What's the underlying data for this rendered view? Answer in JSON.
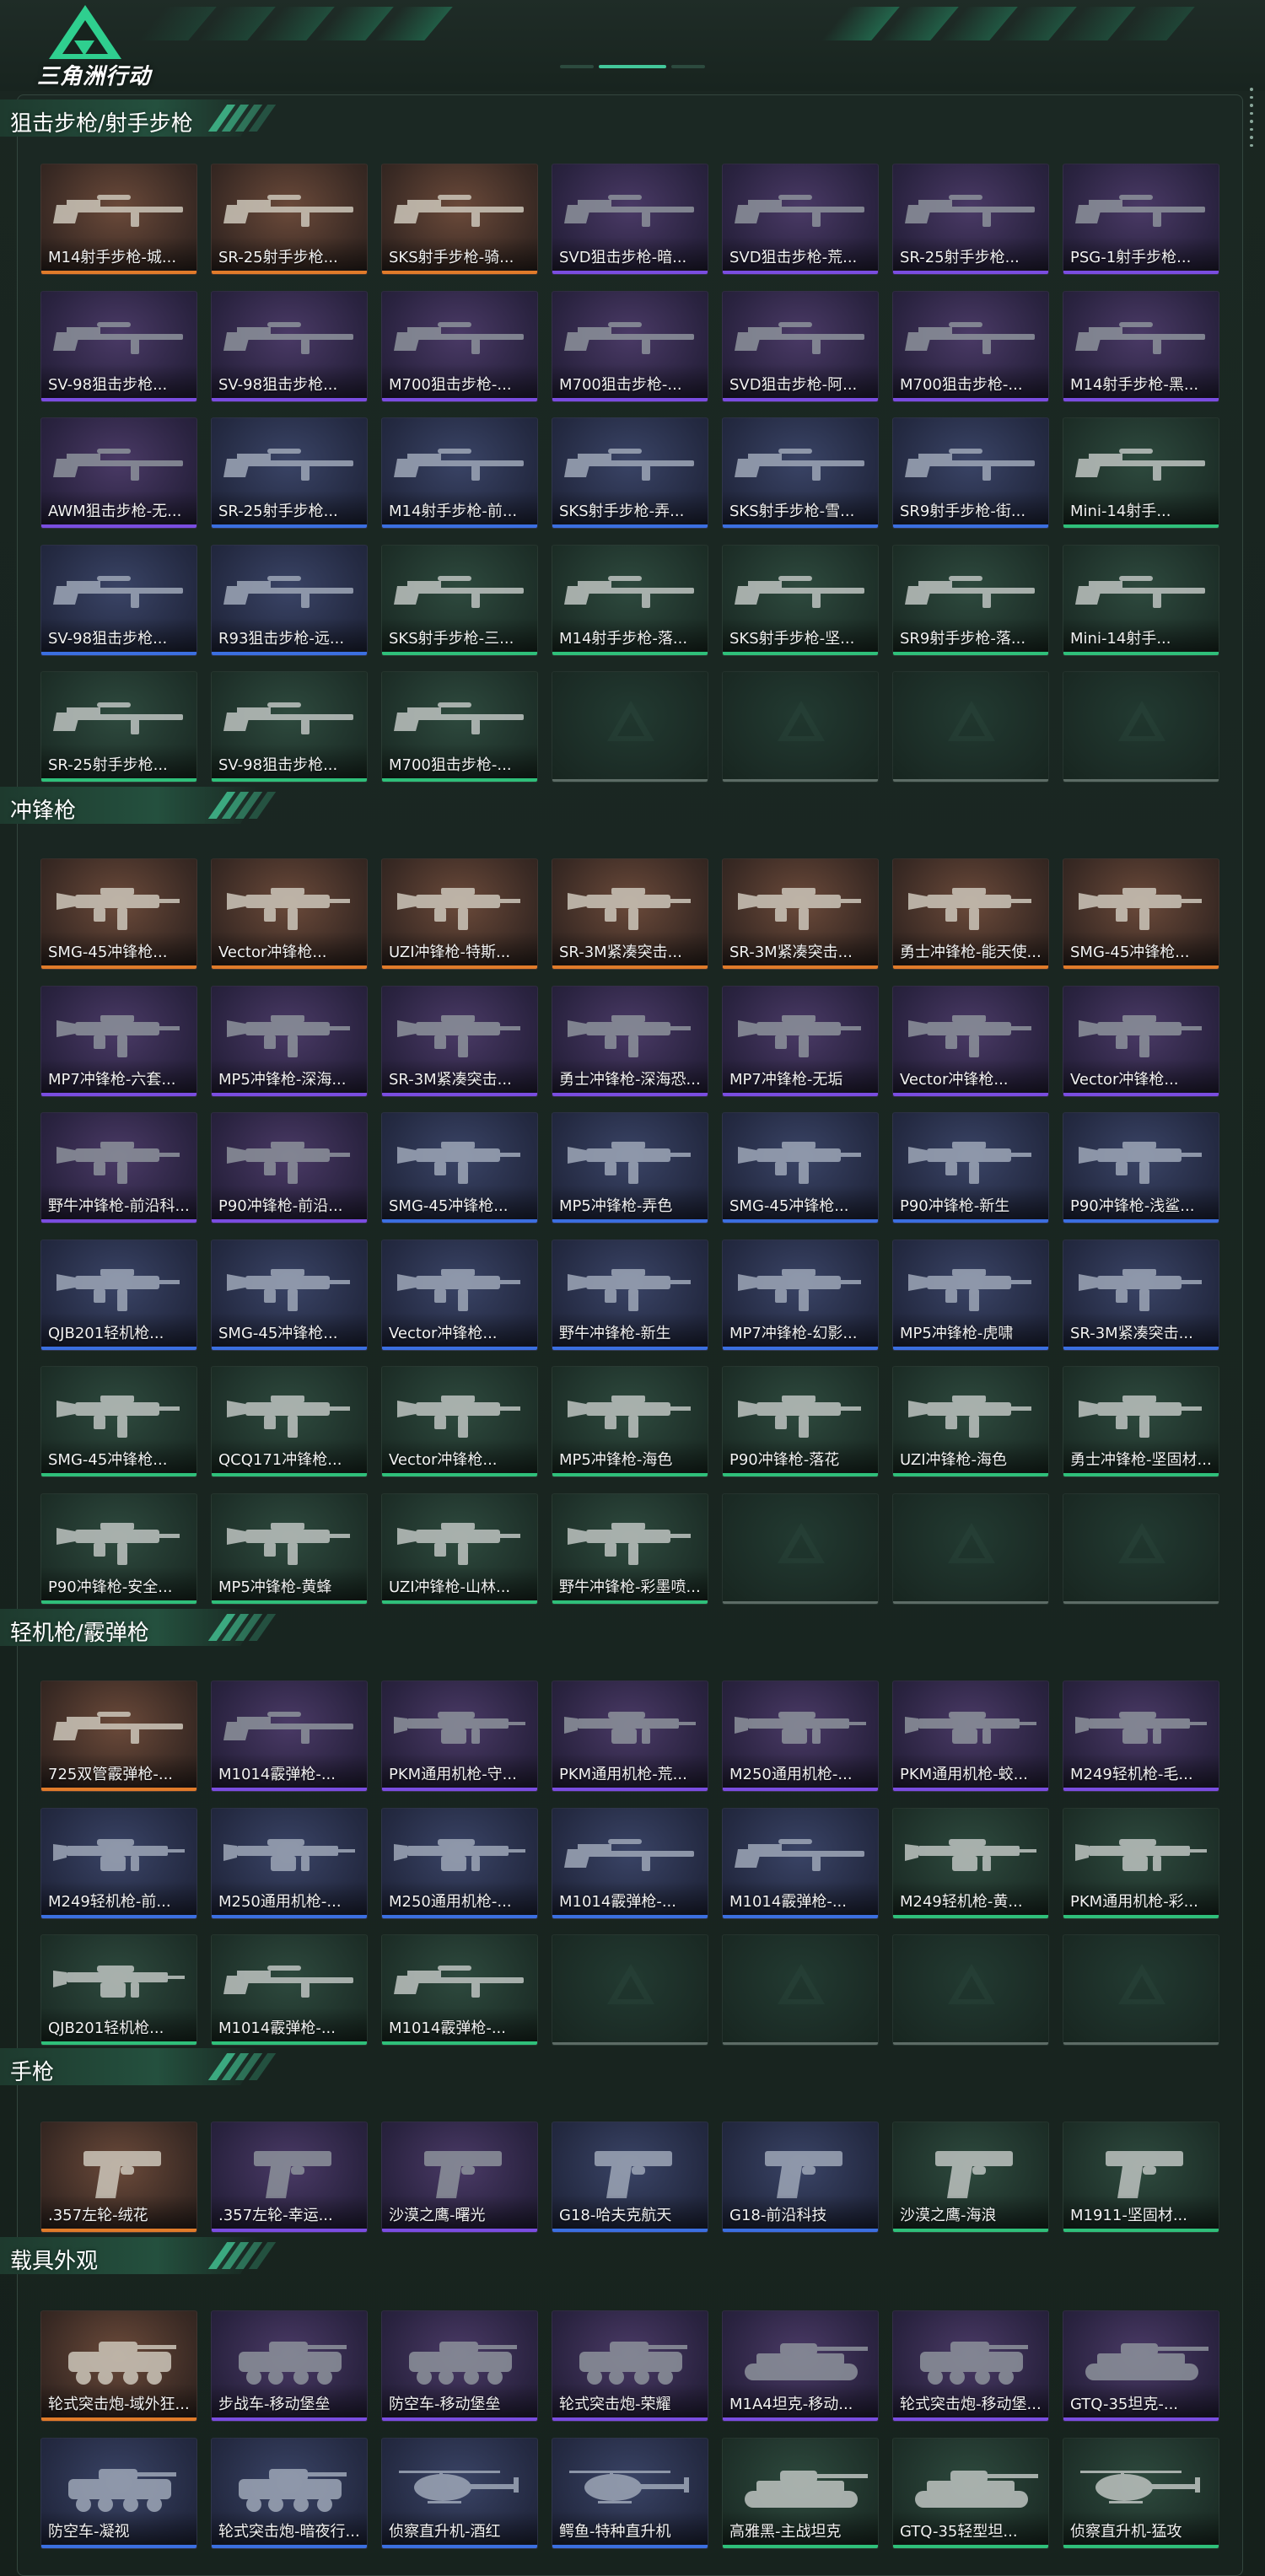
{
  "header": {
    "logo_text": "三角洲行动",
    "accent": "#43c79a"
  },
  "colors": {
    "orange": "#e07b2a",
    "purple": "#7a4de0",
    "blue": "#3b6fe0",
    "green": "#2fbf7a"
  },
  "sections": [
    {
      "title": "狙击步枪/射手步枪",
      "items": [
        {
          "label": "M14射手步枪-城...",
          "rarity": "orange",
          "kind": "rifle"
        },
        {
          "label": "SR-25射手步枪...",
          "rarity": "orange",
          "kind": "rifle"
        },
        {
          "label": "SKS射手步枪-骑...",
          "rarity": "orange",
          "kind": "rifle"
        },
        {
          "label": "SVD狙击步枪-暗...",
          "rarity": "purple",
          "kind": "rifle"
        },
        {
          "label": "SVD狙击步枪-荒...",
          "rarity": "purple",
          "kind": "rifle"
        },
        {
          "label": "SR-25射手步枪...",
          "rarity": "purple",
          "kind": "rifle"
        },
        {
          "label": "PSG-1射手步枪...",
          "rarity": "purple",
          "kind": "rifle"
        },
        {
          "label": "SV-98狙击步枪...",
          "rarity": "purple",
          "kind": "rifle"
        },
        {
          "label": "SV-98狙击步枪...",
          "rarity": "purple",
          "kind": "rifle"
        },
        {
          "label": "M700狙击步枪-...",
          "rarity": "purple",
          "kind": "rifle"
        },
        {
          "label": "M700狙击步枪-...",
          "rarity": "purple",
          "kind": "rifle"
        },
        {
          "label": "SVD狙击步枪-阿...",
          "rarity": "purple",
          "kind": "rifle"
        },
        {
          "label": "M700狙击步枪-...",
          "rarity": "purple",
          "kind": "rifle"
        },
        {
          "label": "M14射手步枪-黑...",
          "rarity": "purple",
          "kind": "rifle"
        },
        {
          "label": "AWM狙击步枪-无...",
          "rarity": "purple",
          "kind": "rifle"
        },
        {
          "label": "SR-25射手步枪...",
          "rarity": "blue",
          "kind": "rifle"
        },
        {
          "label": "M14射手步枪-前...",
          "rarity": "blue",
          "kind": "rifle"
        },
        {
          "label": "SKS射手步枪-弄...",
          "rarity": "blue",
          "kind": "rifle"
        },
        {
          "label": "SKS射手步枪-雪...",
          "rarity": "blue",
          "kind": "rifle"
        },
        {
          "label": "SR9射手步枪-街...",
          "rarity": "blue",
          "kind": "rifle"
        },
        {
          "label": "Mini-14射手...",
          "rarity": "green",
          "kind": "rifle"
        },
        {
          "label": "SV-98狙击步枪...",
          "rarity": "blue",
          "kind": "rifle"
        },
        {
          "label": "R93狙击步枪-远...",
          "rarity": "blue",
          "kind": "rifle"
        },
        {
          "label": "SKS射手步枪-三...",
          "rarity": "green",
          "kind": "rifle"
        },
        {
          "label": "M14射手步枪-落...",
          "rarity": "green",
          "kind": "rifle"
        },
        {
          "label": "SKS射手步枪-坚...",
          "rarity": "green",
          "kind": "rifle"
        },
        {
          "label": "SR9射手步枪-落...",
          "rarity": "green",
          "kind": "rifle"
        },
        {
          "label": "Mini-14射手...",
          "rarity": "green",
          "kind": "rifle"
        },
        {
          "label": "SR-25射手步枪...",
          "rarity": "green",
          "kind": "rifle"
        },
        {
          "label": "SV-98狙击步枪...",
          "rarity": "green",
          "kind": "rifle"
        },
        {
          "label": "M700狙击步枪-...",
          "rarity": "green",
          "kind": "rifle"
        },
        {
          "label": "",
          "rarity": "empty"
        },
        {
          "label": "",
          "rarity": "empty"
        },
        {
          "label": "",
          "rarity": "empty"
        },
        {
          "label": "",
          "rarity": "empty"
        }
      ]
    },
    {
      "title": "冲锋枪",
      "items": [
        {
          "label": "SMG-45冲锋枪...",
          "rarity": "orange",
          "kind": "smg"
        },
        {
          "label": "Vector冲锋枪...",
          "rarity": "orange",
          "kind": "smg"
        },
        {
          "label": "UZI冲锋枪-特斯...",
          "rarity": "orange",
          "kind": "smg"
        },
        {
          "label": "SR-3M紧凑突击...",
          "rarity": "orange",
          "kind": "smg"
        },
        {
          "label": "SR-3M紧凑突击...",
          "rarity": "orange",
          "kind": "smg"
        },
        {
          "label": "勇士冲锋枪-能天使...",
          "rarity": "orange",
          "kind": "smg"
        },
        {
          "label": "SMG-45冲锋枪...",
          "rarity": "orange",
          "kind": "smg"
        },
        {
          "label": "MP7冲锋枪-六套...",
          "rarity": "purple",
          "kind": "smg"
        },
        {
          "label": "MP5冲锋枪-深海...",
          "rarity": "purple",
          "kind": "smg"
        },
        {
          "label": "SR-3M紧凑突击...",
          "rarity": "purple",
          "kind": "smg"
        },
        {
          "label": "勇士冲锋枪-深海恐...",
          "rarity": "purple",
          "kind": "smg"
        },
        {
          "label": "MP7冲锋枪-无垢",
          "rarity": "purple",
          "kind": "smg"
        },
        {
          "label": "Vector冲锋枪...",
          "rarity": "purple",
          "kind": "smg"
        },
        {
          "label": "Vector冲锋枪...",
          "rarity": "purple",
          "kind": "smg"
        },
        {
          "label": "野牛冲锋枪-前沿科...",
          "rarity": "purple",
          "kind": "smg"
        },
        {
          "label": "P90冲锋枪-前沿...",
          "rarity": "purple",
          "kind": "smg"
        },
        {
          "label": "SMG-45冲锋枪...",
          "rarity": "blue",
          "kind": "smg"
        },
        {
          "label": "MP5冲锋枪-弄色",
          "rarity": "blue",
          "kind": "smg"
        },
        {
          "label": "SMG-45冲锋枪...",
          "rarity": "blue",
          "kind": "smg"
        },
        {
          "label": "P90冲锋枪-新生",
          "rarity": "blue",
          "kind": "smg"
        },
        {
          "label": "P90冲锋枪-浅鲨...",
          "rarity": "blue",
          "kind": "smg"
        },
        {
          "label": "QJB201轻机枪...",
          "rarity": "blue",
          "kind": "smg"
        },
        {
          "label": "SMG-45冲锋枪...",
          "rarity": "blue",
          "kind": "smg"
        },
        {
          "label": "Vector冲锋枪...",
          "rarity": "blue",
          "kind": "smg"
        },
        {
          "label": "野牛冲锋枪-新生",
          "rarity": "blue",
          "kind": "smg"
        },
        {
          "label": "MP7冲锋枪-幻影...",
          "rarity": "blue",
          "kind": "smg"
        },
        {
          "label": "MP5冲锋枪-虎啸",
          "rarity": "blue",
          "kind": "smg"
        },
        {
          "label": "SR-3M紧凑突击...",
          "rarity": "blue",
          "kind": "smg"
        },
        {
          "label": "SMG-45冲锋枪...",
          "rarity": "green",
          "kind": "smg"
        },
        {
          "label": "QCQ171冲锋枪...",
          "rarity": "green",
          "kind": "smg"
        },
        {
          "label": "Vector冲锋枪...",
          "rarity": "green",
          "kind": "smg"
        },
        {
          "label": "MP5冲锋枪-海色",
          "rarity": "green",
          "kind": "smg"
        },
        {
          "label": "P90冲锋枪-落花",
          "rarity": "green",
          "kind": "smg"
        },
        {
          "label": "UZI冲锋枪-海色",
          "rarity": "green",
          "kind": "smg"
        },
        {
          "label": "勇士冲锋枪-坚固材...",
          "rarity": "green",
          "kind": "smg"
        },
        {
          "label": "P90冲锋枪-安全...",
          "rarity": "green",
          "kind": "smg"
        },
        {
          "label": "MP5冲锋枪-黄蜂",
          "rarity": "green",
          "kind": "smg"
        },
        {
          "label": "UZI冲锋枪-山林...",
          "rarity": "green",
          "kind": "smg"
        },
        {
          "label": "野牛冲锋枪-彩墨喷...",
          "rarity": "green",
          "kind": "smg"
        },
        {
          "label": "",
          "rarity": "empty"
        },
        {
          "label": "",
          "rarity": "empty"
        },
        {
          "label": "",
          "rarity": "empty"
        }
      ]
    },
    {
      "title": "轻机枪/霰弹枪",
      "items": [
        {
          "label": "725双管霰弹枪-...",
          "rarity": "orange",
          "kind": "rifle"
        },
        {
          "label": "M1014霰弹枪-...",
          "rarity": "purple",
          "kind": "rifle"
        },
        {
          "label": "PKM通用机枪-守...",
          "rarity": "purple",
          "kind": "lmg"
        },
        {
          "label": "PKM通用机枪-荒...",
          "rarity": "purple",
          "kind": "lmg"
        },
        {
          "label": "M250通用机枪-...",
          "rarity": "purple",
          "kind": "lmg"
        },
        {
          "label": "PKM通用机枪-蛟...",
          "rarity": "purple",
          "kind": "lmg"
        },
        {
          "label": "M249轻机枪-毛...",
          "rarity": "purple",
          "kind": "lmg"
        },
        {
          "label": "M249轻机枪-前...",
          "rarity": "blue",
          "kind": "lmg"
        },
        {
          "label": "M250通用机枪-...",
          "rarity": "blue",
          "kind": "lmg"
        },
        {
          "label": "M250通用机枪-...",
          "rarity": "blue",
          "kind": "lmg"
        },
        {
          "label": "M1014霰弹枪-...",
          "rarity": "blue",
          "kind": "rifle"
        },
        {
          "label": "M1014霰弹枪-...",
          "rarity": "blue",
          "kind": "rifle"
        },
        {
          "label": "M249轻机枪-黄...",
          "rarity": "green",
          "kind": "lmg"
        },
        {
          "label": "PKM通用机枪-彩...",
          "rarity": "green",
          "kind": "lmg"
        },
        {
          "label": "QJB201轻机枪...",
          "rarity": "green",
          "kind": "lmg"
        },
        {
          "label": "M1014霰弹枪-...",
          "rarity": "green",
          "kind": "rifle"
        },
        {
          "label": "M1014霰弹枪-...",
          "rarity": "green",
          "kind": "rifle"
        },
        {
          "label": "",
          "rarity": "empty"
        },
        {
          "label": "",
          "rarity": "empty"
        },
        {
          "label": "",
          "rarity": "empty"
        },
        {
          "label": "",
          "rarity": "empty"
        }
      ]
    },
    {
      "title": "手枪",
      "items": [
        {
          "label": ".357左轮-绒花",
          "rarity": "orange",
          "kind": "pistol"
        },
        {
          "label": ".357左轮-幸运...",
          "rarity": "purple",
          "kind": "pistol"
        },
        {
          "label": "沙漠之鹰-曙光",
          "rarity": "purple",
          "kind": "pistol"
        },
        {
          "label": "G18-哈夫克航天",
          "rarity": "blue",
          "kind": "pistol"
        },
        {
          "label": "G18-前沿科技",
          "rarity": "blue",
          "kind": "pistol"
        },
        {
          "label": "沙漠之鹰-海浪",
          "rarity": "green",
          "kind": "pistol"
        },
        {
          "label": "M1911-坚固材...",
          "rarity": "green",
          "kind": "pistol"
        }
      ]
    },
    {
      "title": "载具外观",
      "items": [
        {
          "label": "轮式突击炮-域外狂...",
          "rarity": "orange",
          "kind": "vehicle"
        },
        {
          "label": "步战车-移动堡垒",
          "rarity": "purple",
          "kind": "vehicle"
        },
        {
          "label": "防空车-移动堡垒",
          "rarity": "purple",
          "kind": "vehicle"
        },
        {
          "label": "轮式突击炮-荣耀",
          "rarity": "purple",
          "kind": "vehicle"
        },
        {
          "label": "M1A4坦克-移动...",
          "rarity": "purple",
          "kind": "tank"
        },
        {
          "label": "轮式突击炮-移动堡...",
          "rarity": "purple",
          "kind": "vehicle"
        },
        {
          "label": "GTQ-35坦克-...",
          "rarity": "purple",
          "kind": "tank"
        },
        {
          "label": "防空车-凝视",
          "rarity": "blue",
          "kind": "vehicle"
        },
        {
          "label": "轮式突击炮-暗夜行...",
          "rarity": "blue",
          "kind": "vehicle"
        },
        {
          "label": "侦察直升机-酒红",
          "rarity": "blue",
          "kind": "heli"
        },
        {
          "label": "鳄鱼-特种直升机",
          "rarity": "blue",
          "kind": "heli"
        },
        {
          "label": "高雅黑-主战坦克",
          "rarity": "green",
          "kind": "tank"
        },
        {
          "label": "GTQ-35轻型坦...",
          "rarity": "green",
          "kind": "tank"
        },
        {
          "label": "侦察直升机-猛攻",
          "rarity": "green",
          "kind": "heli"
        }
      ]
    }
  ]
}
